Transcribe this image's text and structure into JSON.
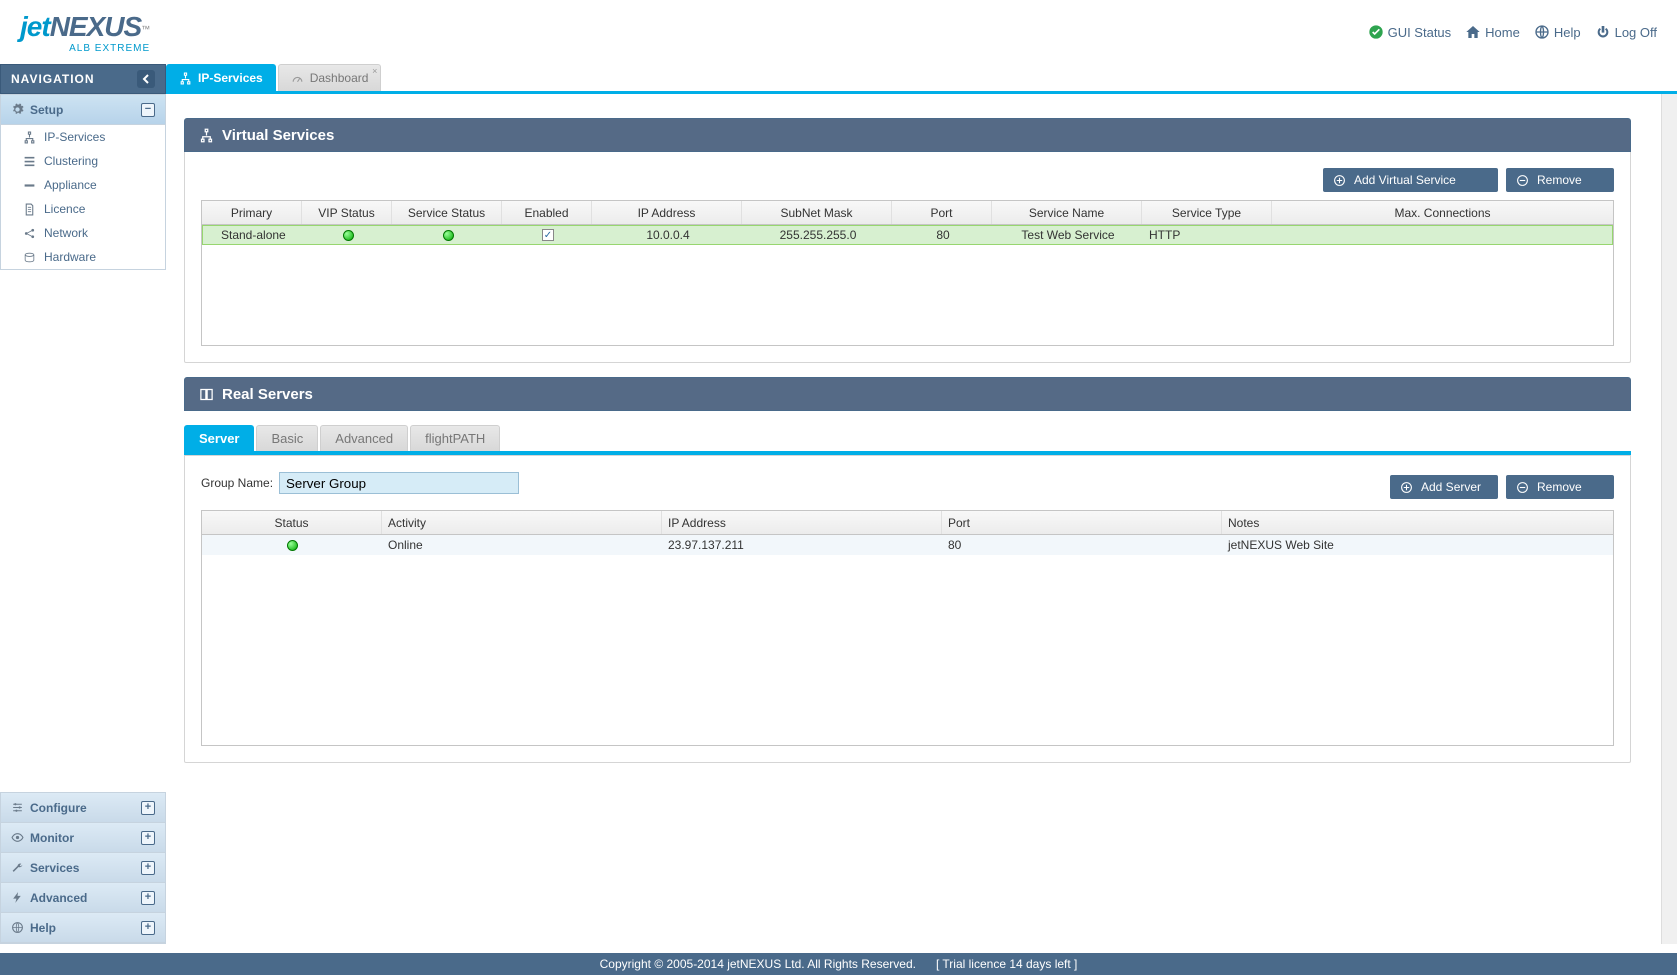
{
  "brand": {
    "jet": "jet",
    "nexus": "NEXUS",
    "sub": "ALB EXTREME",
    "tm": "™"
  },
  "header_links": {
    "gui_status": "GUI Status",
    "home": "Home",
    "help": "Help",
    "logoff": "Log Off"
  },
  "sidebar": {
    "title": "NAVIGATION",
    "groups": [
      {
        "label": "Setup",
        "expanded": true,
        "items": [
          {
            "label": "IP-Services",
            "icon": "sitemap"
          },
          {
            "label": "Clustering",
            "icon": "bars"
          },
          {
            "label": "Appliance",
            "icon": "dash"
          },
          {
            "label": "Licence",
            "icon": "doc"
          },
          {
            "label": "Network",
            "icon": "share"
          },
          {
            "label": "Hardware",
            "icon": "disk"
          }
        ]
      },
      {
        "label": "Configure",
        "expanded": false
      },
      {
        "label": "Monitor",
        "expanded": false
      },
      {
        "label": "Services",
        "expanded": false
      },
      {
        "label": "Advanced",
        "expanded": false
      },
      {
        "label": "Help",
        "expanded": false
      }
    ]
  },
  "tabs": [
    {
      "label": "IP-Services",
      "active": true
    },
    {
      "label": "Dashboard",
      "active": false
    }
  ],
  "virtual_services": {
    "title": "Virtual Services",
    "buttons": {
      "add": "Add Virtual Service",
      "remove": "Remove"
    },
    "columns": [
      "Primary",
      "VIP Status",
      "Service Status",
      "Enabled",
      "IP Address",
      "SubNet Mask",
      "Port",
      "Service Name",
      "Service Type",
      "Max. Connections"
    ],
    "rows": [
      {
        "primary": "Stand-alone",
        "vip_status": "green",
        "service_status": "green",
        "enabled": true,
        "ip": "10.0.0.4",
        "mask": "255.255.255.0",
        "port": "80",
        "name": "Test Web Service",
        "type": "HTTP",
        "max": ""
      }
    ]
  },
  "real_servers": {
    "title": "Real Servers",
    "tabs": [
      "Server",
      "Basic",
      "Advanced",
      "flightPATH"
    ],
    "active_tab": "Server",
    "group_name_label": "Group Name:",
    "group_name_value": "Server Group",
    "buttons": {
      "add": "Add Server",
      "remove": "Remove"
    },
    "columns": [
      "Status",
      "Activity",
      "IP Address",
      "Port",
      "Notes"
    ],
    "rows": [
      {
        "status": "green",
        "activity": "Online",
        "ip": "23.97.137.211",
        "port": "80",
        "notes": "jetNEXUS Web Site"
      }
    ]
  },
  "footer": {
    "copyright": "Copyright © 2005-2014 jetNEXUS Ltd. All Rights Reserved.",
    "trial": "[ Trial licence 14 days left ]"
  }
}
